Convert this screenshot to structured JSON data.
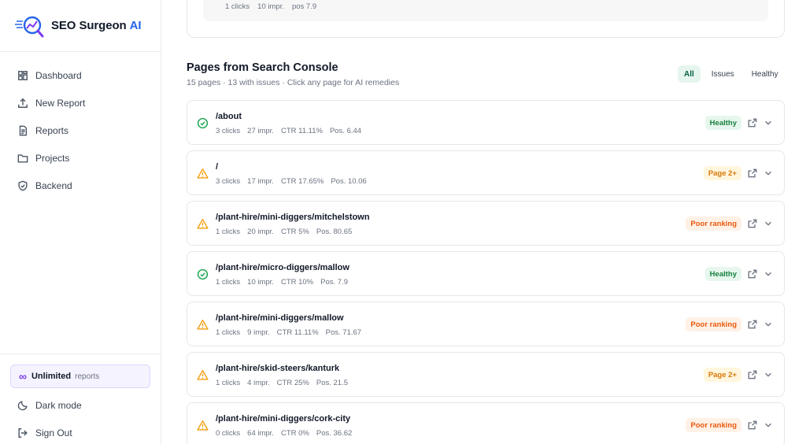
{
  "brand": {
    "name": "SEO Surgeon",
    "ai": "AI",
    "accent": "#2563eb"
  },
  "nav": [
    {
      "key": "dashboard",
      "label": "Dashboard",
      "icon": "dashboard-grid-icon"
    },
    {
      "key": "new-report",
      "label": "New Report",
      "icon": "upload-icon"
    },
    {
      "key": "reports",
      "label": "Reports",
      "icon": "document-icon"
    },
    {
      "key": "projects",
      "label": "Projects",
      "icon": "folder-icon"
    },
    {
      "key": "backend",
      "label": "Backend",
      "icon": "shield-icon"
    }
  ],
  "plan": {
    "label": "Unlimited",
    "sub": "reports"
  },
  "bottom_nav": [
    {
      "key": "dark-mode",
      "label": "Dark mode",
      "icon": "moon-icon"
    },
    {
      "key": "sign-out",
      "label": "Sign Out",
      "icon": "sign-out-icon"
    }
  ],
  "previous_card": {
    "clicks": "1 clicks",
    "impr": "10 impr.",
    "pos": "pos 7.9"
  },
  "section": {
    "title": "Pages from Search Console",
    "subtitle": "15 pages · 13 with issues · Click any page for AI remedies"
  },
  "filters": [
    {
      "label": "All",
      "active": true
    },
    {
      "label": "Issues",
      "active": false
    },
    {
      "label": "Healthy",
      "active": false
    }
  ],
  "pages": [
    {
      "path": "/about",
      "clicks": "3 clicks",
      "impr": "27 impr.",
      "ctr": "CTR 11.11%",
      "pos": "Pos. 6.44",
      "status": "Healthy",
      "kind": "healthy"
    },
    {
      "path": "/",
      "clicks": "3 clicks",
      "impr": "17 impr.",
      "ctr": "CTR 17.65%",
      "pos": "Pos. 10.06",
      "status": "Page 2+",
      "kind": "page2"
    },
    {
      "path": "/plant-hire/mini-diggers/mitchelstown",
      "clicks": "1 clicks",
      "impr": "20 impr.",
      "ctr": "CTR 5%",
      "pos": "Pos. 80.65",
      "status": "Poor ranking",
      "kind": "poor"
    },
    {
      "path": "/plant-hire/micro-diggers/mallow",
      "clicks": "1 clicks",
      "impr": "10 impr.",
      "ctr": "CTR 10%",
      "pos": "Pos. 7.9",
      "status": "Healthy",
      "kind": "healthy"
    },
    {
      "path": "/plant-hire/mini-diggers/mallow",
      "clicks": "1 clicks",
      "impr": "9 impr.",
      "ctr": "CTR 11.11%",
      "pos": "Pos. 71.67",
      "status": "Poor ranking",
      "kind": "poor"
    },
    {
      "path": "/plant-hire/skid-steers/kanturk",
      "clicks": "1 clicks",
      "impr": "4 impr.",
      "ctr": "CTR 25%",
      "pos": "Pos. 21.5",
      "status": "Page 2+",
      "kind": "page2"
    },
    {
      "path": "/plant-hire/mini-diggers/cork-city",
      "clicks": "0 clicks",
      "impr": "64 impr.",
      "ctr": "CTR 0%",
      "pos": "Pos. 36.62",
      "status": "Poor ranking",
      "kind": "poor"
    }
  ],
  "colors": {
    "healthy": "#16a34a",
    "warning": "#f59e0b",
    "poor": "#ea580c"
  }
}
